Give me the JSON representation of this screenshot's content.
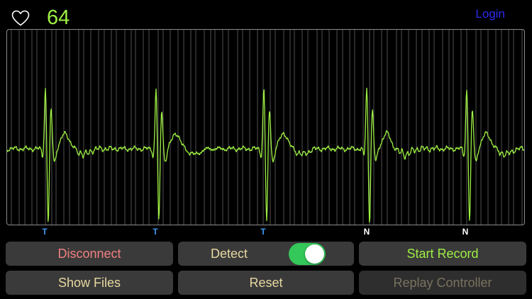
{
  "header": {
    "heart_icon": "heart-outline-icon",
    "bpm": "64",
    "login_label": "Login"
  },
  "ecg": {
    "line_color": "#9EF043",
    "grid_color": "#9A9A9A",
    "beat_labels": [
      {
        "label": "T",
        "color": "#3E95F0"
      },
      {
        "label": "T",
        "color": "#3E95F0"
      },
      {
        "label": "T",
        "color": "#3E95F0"
      },
      {
        "label": "N",
        "color": "#FFFFFF"
      },
      {
        "label": "N",
        "color": "#FFFFFF"
      }
    ]
  },
  "controls": {
    "disconnect_label": "Disconnect",
    "detect_label": "Detect",
    "detect_enabled": true,
    "start_record_label": "Start Record",
    "show_files_label": "Show Files",
    "reset_label": "Reset",
    "replay_controller_label": "Replay Controller"
  },
  "colors": {
    "disconnect": "#F08080",
    "neutral_text": "#E8D8A0",
    "start_record": "#9EF043",
    "disabled_text": "#7A7260",
    "button_bg": "#3A3A3A",
    "toggle_on": "#34C759"
  }
}
